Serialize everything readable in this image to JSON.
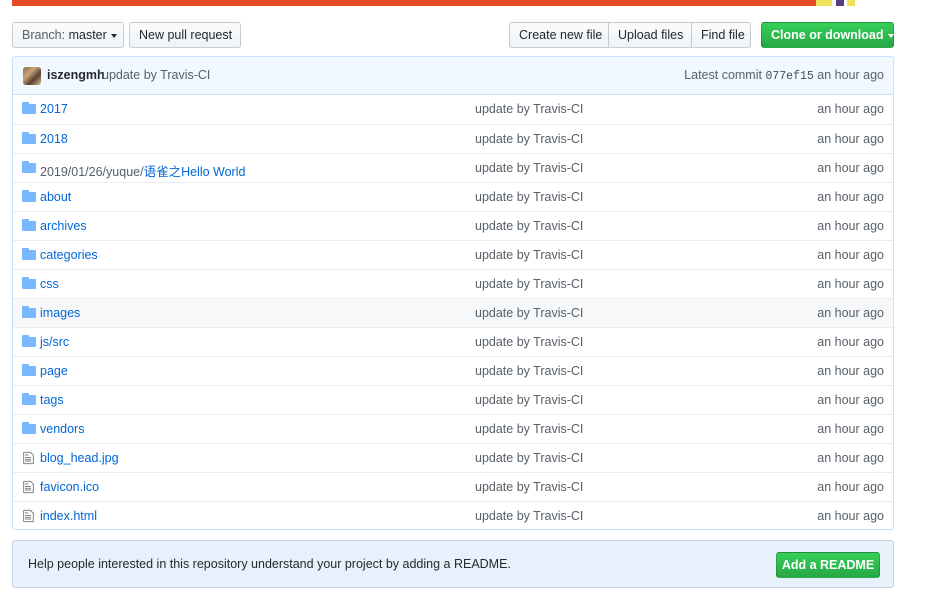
{
  "language_bar": [
    {
      "color": "#e34c26",
      "share": 0.912
    },
    {
      "color": "#f1e05a",
      "share": 0.018
    },
    {
      "color": "#ffffff",
      "share": 0.004
    },
    {
      "color": "#563d7c",
      "share": 0.009
    },
    {
      "color": "#ffffff",
      "share": 0.004
    },
    {
      "color": "#f1e05a",
      "share": 0.009
    }
  ],
  "toolbar": {
    "branch_label": "Branch:",
    "branch_name": "master",
    "new_pr": "New pull request",
    "create_file": "Create new file",
    "upload_files": "Upload files",
    "find_file": "Find file",
    "clone": "Clone or download"
  },
  "commit": {
    "author": "iszengmh",
    "message": "update by Travis-CI",
    "latest_label": "Latest commit",
    "sha": "077ef15",
    "time": "an hour ago"
  },
  "files": [
    {
      "type": "dir",
      "name": "2017",
      "message": "update by Travis-CI",
      "age": "an hour ago"
    },
    {
      "type": "dir",
      "name": "2018",
      "message": "update by Travis-CI",
      "age": "an hour ago"
    },
    {
      "type": "dir",
      "name_prefix": "2019/01/26/yuque/",
      "name": "语雀之Hello World",
      "message": "update by Travis-CI",
      "age": "an hour ago"
    },
    {
      "type": "dir",
      "name": "about",
      "message": "update by Travis-CI",
      "age": "an hour ago"
    },
    {
      "type": "dir",
      "name": "archives",
      "message": "update by Travis-CI",
      "age": "an hour ago"
    },
    {
      "type": "dir",
      "name": "categories",
      "message": "update by Travis-CI",
      "age": "an hour ago"
    },
    {
      "type": "dir",
      "name": "css",
      "message": "update by Travis-CI",
      "age": "an hour ago"
    },
    {
      "type": "dir",
      "name": "images",
      "message": "update by Travis-CI",
      "age": "an hour ago",
      "hover": true
    },
    {
      "type": "dir",
      "name": "js/src",
      "message": "update by Travis-CI",
      "age": "an hour ago"
    },
    {
      "type": "dir",
      "name": "page",
      "message": "update by Travis-CI",
      "age": "an hour ago"
    },
    {
      "type": "dir",
      "name": "tags",
      "message": "update by Travis-CI",
      "age": "an hour ago"
    },
    {
      "type": "dir",
      "name": "vendors",
      "message": "update by Travis-CI",
      "age": "an hour ago"
    },
    {
      "type": "file",
      "name": "blog_head.jpg",
      "message": "update by Travis-CI",
      "age": "an hour ago"
    },
    {
      "type": "file",
      "name": "favicon.ico",
      "message": "update by Travis-CI",
      "age": "an hour ago"
    },
    {
      "type": "file",
      "name": "index.html",
      "message": "update by Travis-CI",
      "age": "an hour ago"
    }
  ],
  "readme": {
    "text": "Help people interested in this repository understand your project by adding a README.",
    "button": "Add a README"
  },
  "colors": {
    "link": "#0366d6",
    "muted": "#586069",
    "folder_icon": "#79b8ff",
    "file_icon": "#6a737d",
    "primary_button": "#28a745"
  }
}
